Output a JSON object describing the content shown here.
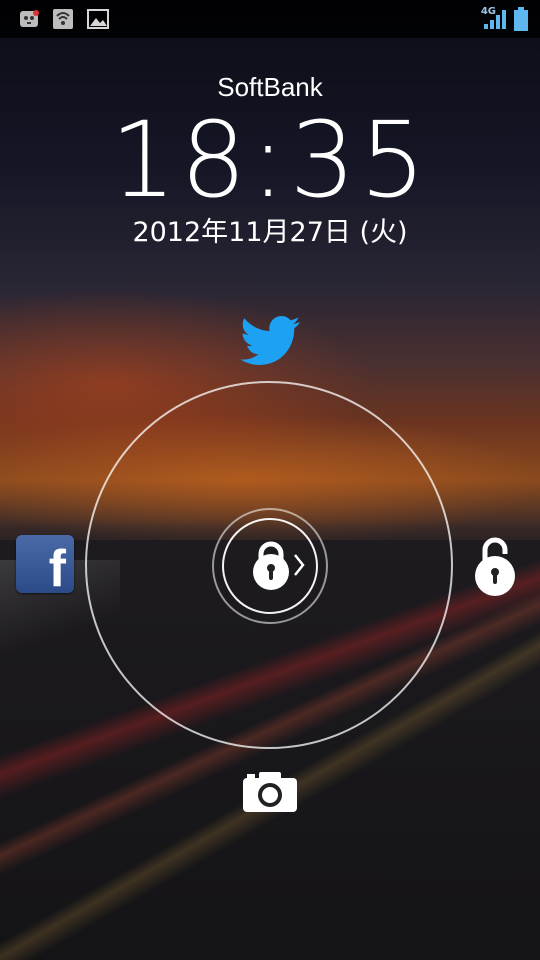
{
  "status_bar": {
    "network_type": "4G",
    "icons": [
      "notification-app-icon",
      "wifi-alert-icon",
      "image-icon",
      "signal-icon",
      "battery-icon"
    ]
  },
  "lockscreen": {
    "carrier": "SoftBank",
    "time": "18:35",
    "date": "2012年11月27日 (火)"
  },
  "unlock_targets": [
    "twitter-icon",
    "facebook-icon",
    "unlock-icon",
    "camera-icon"
  ],
  "facebook_letter": "f",
  "colors": {
    "twitter_blue": "#1da1f2",
    "facebook_blue": "#3b5998",
    "status_bar_icon": "#9fc6e8"
  }
}
